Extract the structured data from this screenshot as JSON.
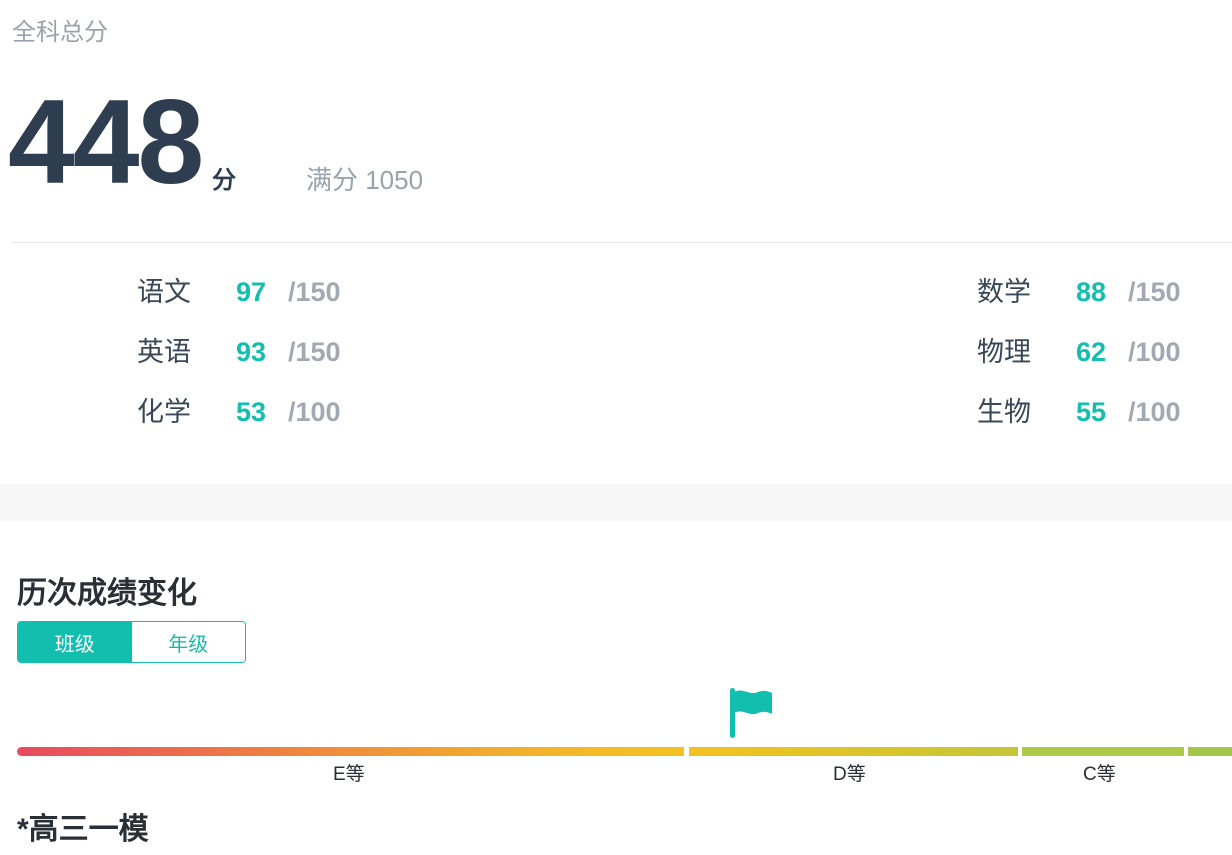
{
  "summary": {
    "label": "全科总分",
    "total": "448",
    "unit": "分",
    "full_label": "满分 1050"
  },
  "subjects": {
    "left": [
      {
        "name": "语文",
        "score": "97",
        "max": "/150"
      },
      {
        "name": "英语",
        "score": "93",
        "max": "/150"
      },
      {
        "name": "化学",
        "score": "53",
        "max": "/100"
      }
    ],
    "right": [
      {
        "name": "数学",
        "score": "88",
        "max": "/150"
      },
      {
        "name": "物理",
        "score": "62",
        "max": "/100"
      },
      {
        "name": "生物",
        "score": "55",
        "max": "/100"
      }
    ]
  },
  "history": {
    "title": "历次成绩变化",
    "tabs": [
      {
        "label": "班级",
        "active": true
      },
      {
        "label": "年级",
        "active": false
      }
    ],
    "grades": [
      "E等",
      "D等",
      "C等"
    ],
    "exam_name": "*高三一模"
  },
  "colors": {
    "accent": "#12bfae",
    "title": "#2e3e50",
    "muted": "#9aa3ab"
  },
  "icons": {
    "marker": "flag-icon"
  }
}
